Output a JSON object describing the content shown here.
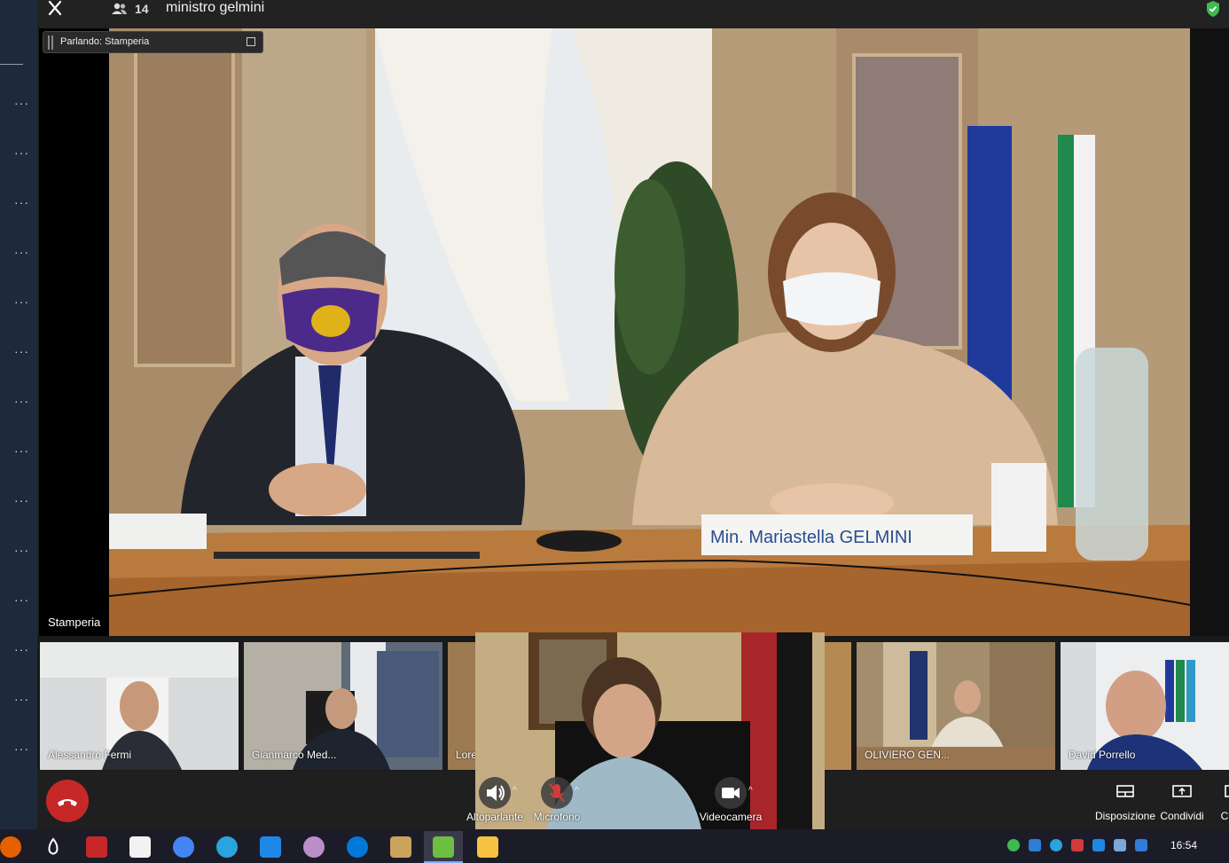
{
  "window": {
    "participant_count": "14",
    "meeting_title": "ministro gelmini",
    "close_icon": "close-icon",
    "participants_icon": "participants-icon",
    "security_icon": "shield-check-icon"
  },
  "main_video": {
    "speaking_label": "Parlando: Stamperia",
    "participant_name": "Stamperia",
    "nameplate_text": "Min. Mariastella GELMINI"
  },
  "thumbnails": [
    {
      "name": "Alessandro Fermi"
    },
    {
      "name": "Gianmarco Med..."
    },
    {
      "name": "Lore"
    },
    {
      "name": "OLIVIERO GEN..."
    },
    {
      "name": "David Porrello"
    }
  ],
  "controls": {
    "speaker_label": "Altoparlante",
    "mic_label": "Microfono",
    "camera_label": "Videocamera",
    "layout_label": "Disposizione",
    "share_label": "Condividi",
    "more_label": "C"
  },
  "taskbar": {
    "clock": "16:54"
  },
  "colors": {
    "hangup": "#c62828",
    "rail": "#1e2a3b",
    "shield": "#3fb950"
  }
}
